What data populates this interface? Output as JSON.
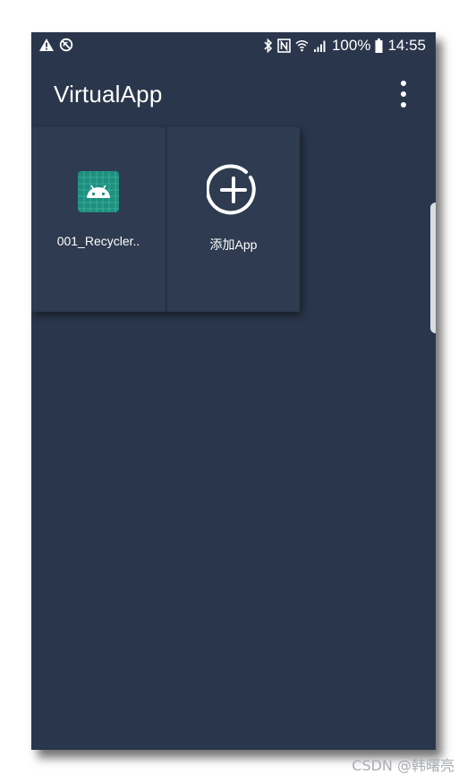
{
  "status_bar": {
    "left_icons": [
      "warning-icon",
      "no-sync-icon"
    ],
    "right_icons": [
      "bluetooth-icon",
      "nfc-icon",
      "wifi-icon",
      "signal-icon",
      "battery-icon"
    ],
    "battery_text": "100%",
    "time": "14:55"
  },
  "app_bar": {
    "title": "VirtualApp",
    "menu_icon": "more-vert-icon"
  },
  "apps": [
    {
      "label": "001_Recycler..",
      "icon": "android-app-icon"
    },
    {
      "label": "添加App",
      "icon": "add-circle-icon"
    }
  ],
  "watermark": "CSDN @韩曙亮",
  "colors": {
    "background": "#2a364b",
    "tile": "#2e3b50",
    "app_icon": "#1e8f7f"
  }
}
